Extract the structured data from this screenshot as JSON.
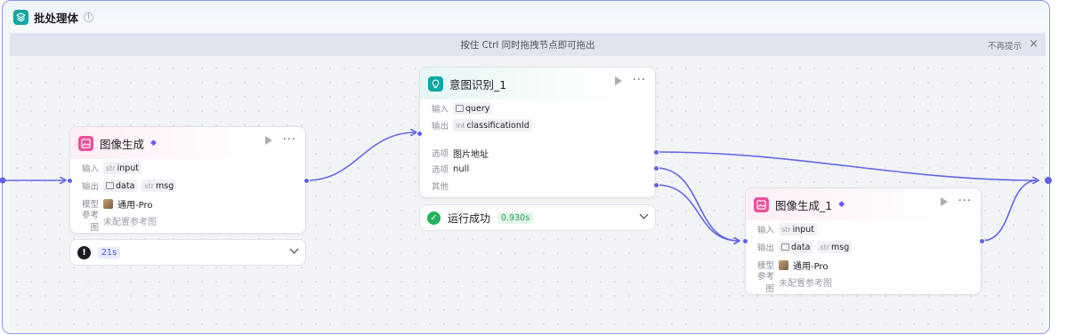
{
  "container": {
    "title": "批处理体",
    "icon": "layers-icon",
    "info_icon": "info-icon"
  },
  "hint": {
    "text": "按住 Ctrl 同时拖拽节点即可拖出",
    "dismiss": "不再提示",
    "close": "×"
  },
  "labels": {
    "input": "输入",
    "output": "输出",
    "model": "模型",
    "reference": "参考图",
    "option": "选项",
    "other": "其他"
  },
  "types": {
    "str": "str",
    "int": "int"
  },
  "nodes": {
    "image_gen": {
      "title": "图像生成",
      "icon": "image-icon",
      "input": "input",
      "outputs": [
        "data",
        "msg"
      ],
      "model": "通用-Pro",
      "reference": "未配置参考图"
    },
    "intent": {
      "title": "意图识别_1",
      "icon": "bulb-icon",
      "input": "query",
      "output": "classificationId",
      "options": [
        "图片地址",
        "null"
      ],
      "other": "其他"
    },
    "image_gen_1": {
      "title": "图像生成_1",
      "icon": "image-icon",
      "input": "input",
      "outputs": [
        "data",
        "msg"
      ],
      "model": "通用-Pro",
      "reference": "未配置参考图"
    }
  },
  "status": {
    "image_gen": {
      "icon": "exclamation-icon",
      "time": "21s"
    },
    "intent": {
      "icon": "check-circle-icon",
      "text": "运行成功",
      "time": "0.930s"
    }
  },
  "colors": {
    "edge": "#6366e8",
    "container_border": "#8f95f2",
    "pink_icon": "#ea4f9c",
    "teal_icon": "#10a8a0",
    "success": "#22b35b"
  }
}
